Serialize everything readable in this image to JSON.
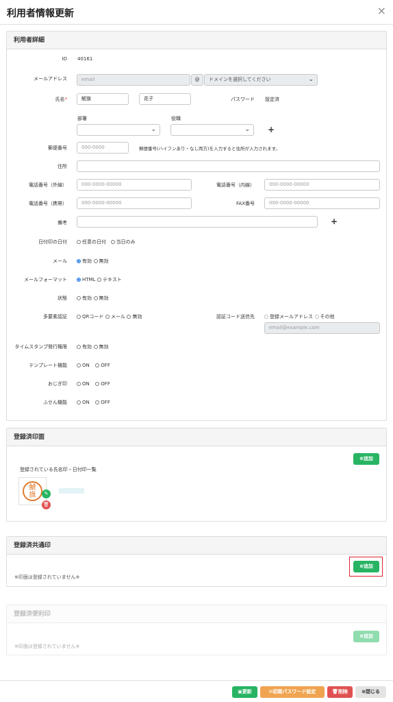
{
  "title": "利用者情報更新",
  "close_icon_glyph": "×",
  "details": {
    "heading": "利用者詳細",
    "id_label": "ID",
    "id_value": "40161",
    "email_label": "メールアドレス",
    "email_value": "email",
    "at_sign": "@",
    "domain_placeholder": "ドメインを選択してください",
    "name_label": "氏名",
    "required_mark": "*",
    "last_name": "鯱旗",
    "first_name": "花子",
    "password_label": "パスワード",
    "password_value": "設定済",
    "dept_label": "部署",
    "role_label": "役職",
    "dept_value": "",
    "role_value": "",
    "add_plus": "+",
    "zip_label": "郵便番号",
    "zip_placeholder": "000-0000",
    "zip_hint": "郵便番号(ハイフンあり・なし両方)を入力すると住所が入力されます。",
    "address_label": "住所",
    "address_value": "",
    "phone_ext_label": "電話番号（外線）",
    "phone_ext_placeholder": "000-0000-00000",
    "phone_int_label": "電話番号（内線）",
    "phone_int_placeholder": "000-0000-00000",
    "mobile_label": "電話番号（携帯）",
    "mobile_placeholder": "000-0000-00000",
    "fax_label": "FAX番号",
    "fax_placeholder": "000-0000-00000",
    "note_label": "備考",
    "note_value": "",
    "date_stamp_label": "日付印の日付",
    "date_stamp_options": [
      "任意の日付",
      "当日のみ"
    ],
    "mail_label": "メール",
    "mail_options": [
      "有効",
      "無効"
    ],
    "mail_format_label": "メールフォーマット",
    "mail_format_options": [
      "HTML",
      "テキスト"
    ],
    "status_label": "状態",
    "status_options": [
      "有効",
      "無効"
    ],
    "mfa_label": "多要素認証",
    "mfa_options": [
      "QRコード",
      "メール",
      "無効"
    ],
    "code_dest_label": "認証コード送信先",
    "code_dest_options": [
      "登録メールアドレス",
      "その他"
    ],
    "code_dest_placeholder": "email@example.com",
    "timestamp_label": "タイムスタンプ発行権限",
    "timestamp_options": [
      "有効",
      "無効"
    ],
    "template_label": "テンプレート機能",
    "template_options": [
      "ON",
      "OFF"
    ],
    "ojigi_label": "おじぎ印",
    "ojigi_options": [
      "ON",
      "OFF"
    ],
    "fusen_label": "ふせん機能",
    "fusen_options": [
      "ON",
      "OFF"
    ]
  },
  "registered_seals": {
    "heading": "登録済印面",
    "add_label": "追加",
    "list_title": "登録されている氏名印・日付印一覧",
    "stamp_chars": [
      "鯱",
      "旗"
    ],
    "stamp_color": "#e07a30"
  },
  "shared_seals": {
    "heading": "登録済共通印",
    "add_label": "追加",
    "empty_text": "※印面は登録されていません※"
  },
  "convenience_seals": {
    "heading": "登録済便利印",
    "add_label": "追加",
    "empty_text": "※印面は登録されていません※"
  },
  "footer": {
    "update_label": "更新",
    "reset_password_label": "初期パスワード設定",
    "delete_label": "削除",
    "close_label": "閉じる"
  },
  "colors": {
    "green": "#28b463",
    "orange": "#f0a450",
    "red": "#e05252",
    "highlight": "#d9232d"
  }
}
